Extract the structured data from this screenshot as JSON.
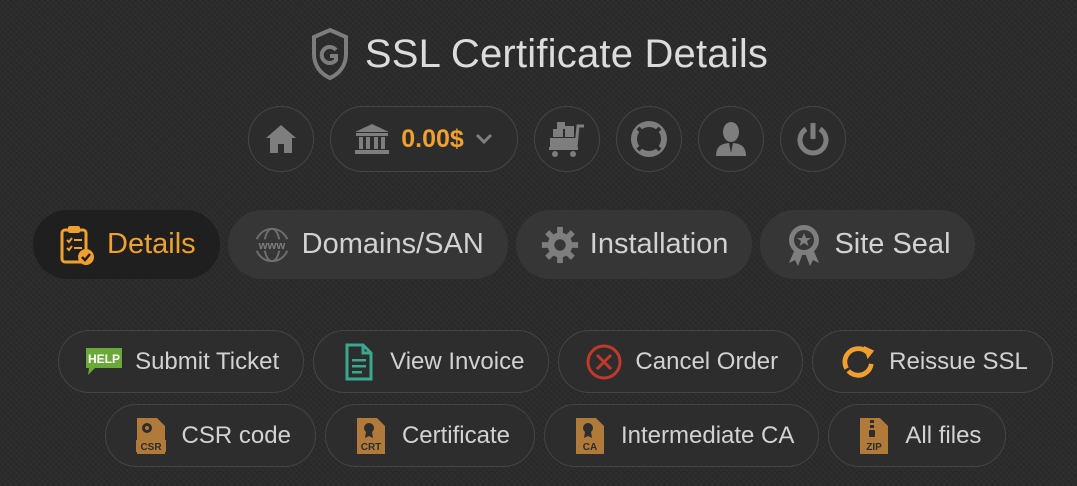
{
  "header": {
    "title": "SSL Certificate Details"
  },
  "nav": {
    "balance": "0.00$",
    "icons": [
      "home-icon",
      "bank-icon",
      "chevron-down-icon",
      "cart-icon",
      "lifebuoy-icon",
      "user-icon",
      "power-icon"
    ]
  },
  "tabs": [
    {
      "label": "Details",
      "icon": "clipboard-check-icon",
      "active": true
    },
    {
      "label": "Domains/SAN",
      "icon": "www-globe-icon",
      "active": false
    },
    {
      "label": "Installation",
      "icon": "gear-icon",
      "active": false
    },
    {
      "label": "Site Seal",
      "icon": "award-seal-icon",
      "active": false
    }
  ],
  "actions_row1": [
    {
      "label": "Submit Ticket",
      "icon": "help-icon",
      "icon_text": "HELP"
    },
    {
      "label": "View Invoice",
      "icon": "document-icon"
    },
    {
      "label": "Cancel Order",
      "icon": "cancel-icon"
    },
    {
      "label": "Reissue SSL",
      "icon": "reissue-icon"
    }
  ],
  "actions_row2": [
    {
      "label": "CSR code",
      "icon": "csr-file-icon",
      "icon_text": "CSR"
    },
    {
      "label": "Certificate",
      "icon": "crt-file-icon",
      "icon_text": "CRT"
    },
    {
      "label": "Intermediate CA",
      "icon": "ca-file-icon",
      "icon_text": "CA"
    },
    {
      "label": "All files",
      "icon": "zip-file-icon",
      "icon_text": "ZIP"
    }
  ],
  "colors": {
    "background": "#2b2b2b",
    "accent": "#f0a030",
    "text": "#d2d2d2",
    "icon_gray": "#7e7e7e",
    "file_brown": "#b07a3a",
    "help_green": "#6aa83a",
    "invoice_teal": "#3aa890",
    "cancel_red": "#c0392b"
  }
}
